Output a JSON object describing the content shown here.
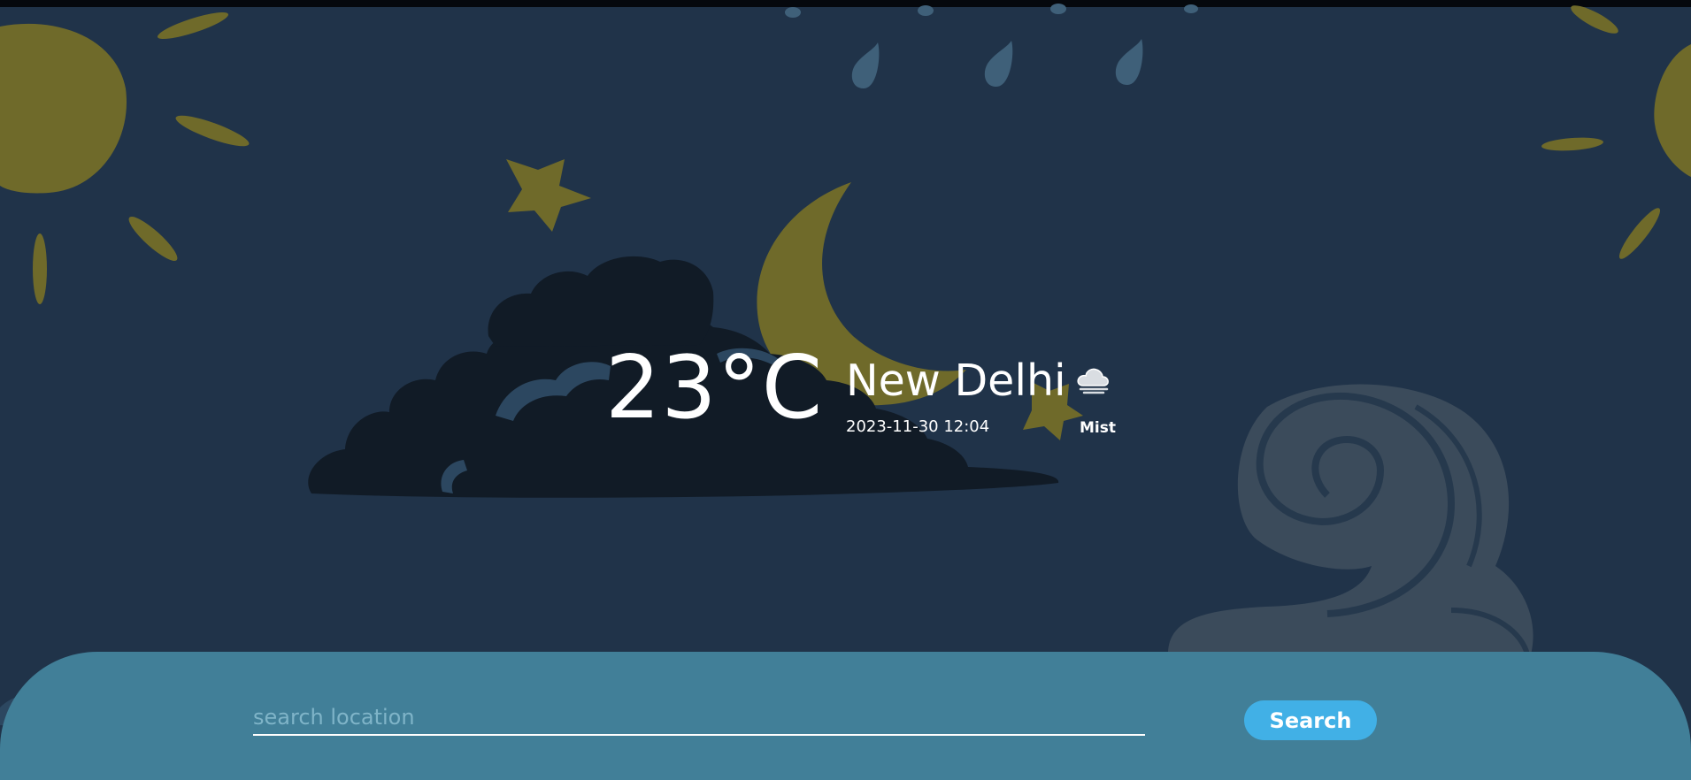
{
  "weather": {
    "temperature": "23°C",
    "city": "New Delhi",
    "datetime": "2023-11-30 12:04",
    "condition": "Mist",
    "condition_icon": "cloud-icon"
  },
  "search": {
    "placeholder": "search location",
    "value": "",
    "button_label": "Search"
  },
  "colors": {
    "background": "#203349",
    "panel": "#417f98",
    "button": "#41b0e6",
    "art_yellow": "#6f6a2a",
    "cloud_dark": "#111b26",
    "swirl": "#3b4b5b"
  }
}
